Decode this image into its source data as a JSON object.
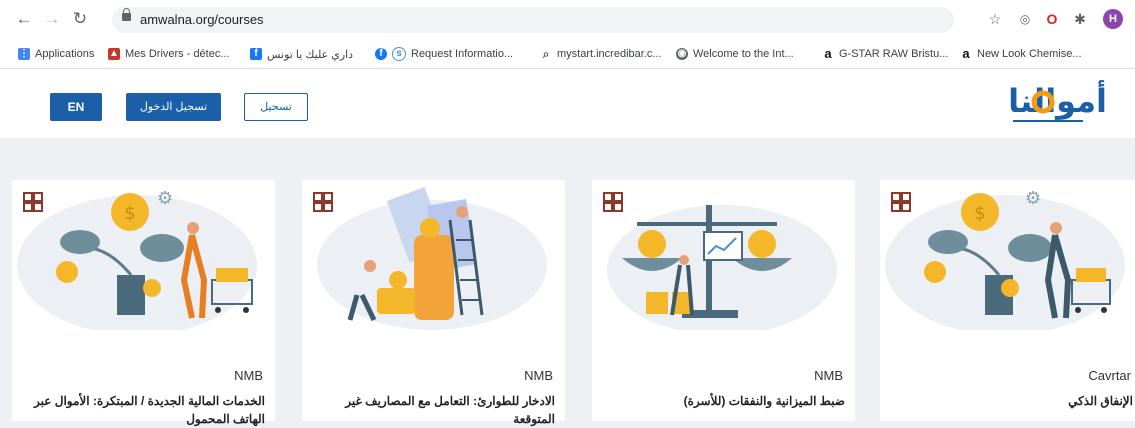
{
  "browser": {
    "url": "amwalna.org/courses",
    "profile_initial": "H",
    "bookmarks": [
      "Applications",
      "Mes Drivers - détec...",
      "داري عليك يا تونس",
      "Request Informatio...",
      "mystart.incredibar.c...",
      "Welcome to the Int...",
      "G-STAR RAW Bristu...",
      "New Look Chemise..."
    ]
  },
  "header": {
    "en_label": "EN",
    "login_label": "تسجيل الدخول",
    "signup_label": "تسجيل",
    "logo_text": "أموالنا"
  },
  "courses": [
    {
      "provider": "Cavrtar",
      "title": "الإنفاق الذكي"
    },
    {
      "provider": "NMB",
      "title": "ضبط الميزانية والنفقات (للأسرة)"
    },
    {
      "provider": "NMB",
      "title": "الادخار للطوارئ: التعامل مع المصاريف غير المتوقعة"
    },
    {
      "provider": "NMB",
      "title": "الخدمات المالية الجديدة / المبتكرة: الأموال عبر الهاتف المحمول"
    }
  ],
  "colors": {
    "brand_blue": "#1b5fa8",
    "logo_orange": "#f39c12",
    "coin": "#f5b72a",
    "leaf": "#5d7c8a"
  }
}
